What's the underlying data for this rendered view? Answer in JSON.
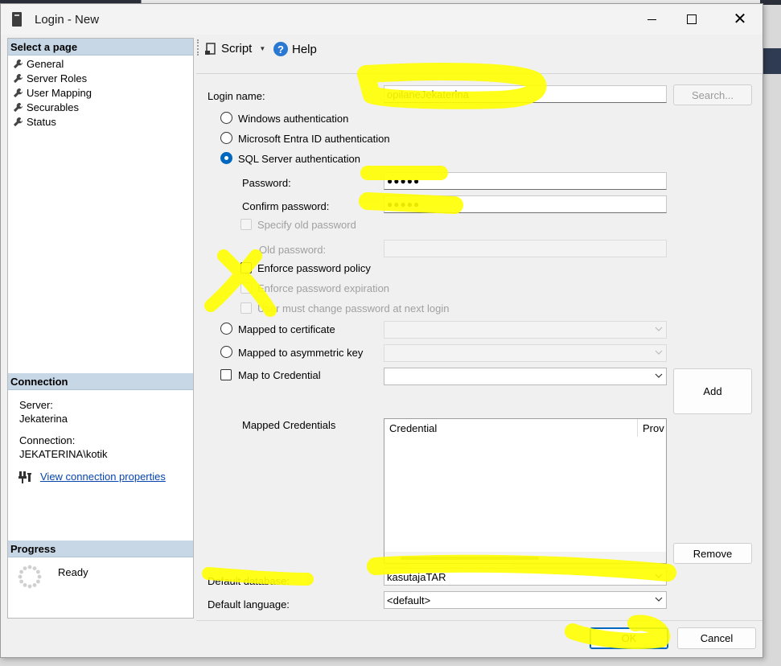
{
  "window": {
    "title": "Login - New"
  },
  "sidebar": {
    "select_page_header": "Select a page",
    "pages": [
      {
        "label": "General"
      },
      {
        "label": "Server Roles"
      },
      {
        "label": "User Mapping"
      },
      {
        "label": "Securables"
      },
      {
        "label": "Status"
      }
    ],
    "connection_header": "Connection",
    "server_label": "Server:",
    "server_value": "Jekaterina",
    "connection_label": "Connection:",
    "connection_value": "JEKATERINA\\kotik",
    "view_connection_link": "View connection properties",
    "progress_header": "Progress",
    "progress_status": "Ready"
  },
  "toolbar": {
    "script_label": "Script",
    "help_label": "Help"
  },
  "form": {
    "login_name_label": "Login name:",
    "login_name_value": "opilaneJekaterina",
    "search_button": "Search...",
    "auth_options": {
      "windows": "Windows authentication",
      "entra": "Microsoft Entra ID authentication",
      "sql": "SQL Server authentication",
      "selected": "sql"
    },
    "password_label": "Password:",
    "password_value": "●●●●●",
    "confirm_password_label": "Confirm password:",
    "confirm_password_value": "●●●●●",
    "specify_old_password_label": "Specify old password",
    "old_password_label": "Old password:",
    "enforce_policy_label": "Enforce password policy",
    "enforce_expiration_label": "Enforce password expiration",
    "must_change_label": "User must change password at next login",
    "mapped_certificate_label": "Mapped to certificate",
    "mapped_asym_key_label": "Mapped to asymmetric key",
    "map_credential_label": "Map to Credential",
    "add_button": "Add",
    "mapped_credentials_label": "Mapped Credentials",
    "credentials_columns": [
      "Credential",
      "Prov"
    ],
    "remove_button": "Remove",
    "default_database_label": "Default database:",
    "default_database_value": "kasutajaTAR",
    "default_language_label": "Default language:",
    "default_language_value": "<default>"
  },
  "footer": {
    "ok_button": "OK",
    "cancel_button": "Cancel"
  },
  "colors": {
    "highlight": "#ffff00",
    "accent": "#0067c0",
    "section_header": "#c8d7e6",
    "link": "#0645ad"
  }
}
